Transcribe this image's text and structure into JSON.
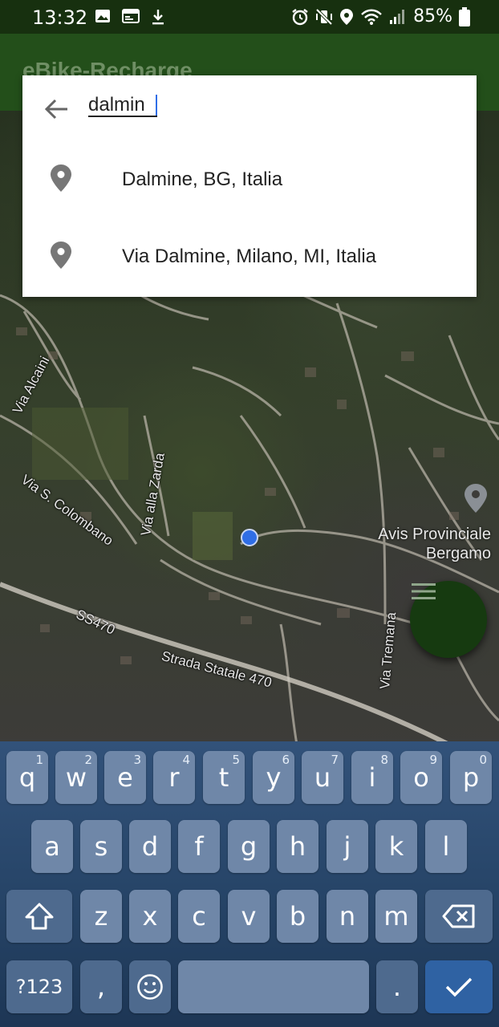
{
  "status_bar": {
    "time": "13:32",
    "battery": "85%",
    "left_icons": [
      "image-icon",
      "calendar-icon",
      "download-icon"
    ],
    "right_icons": [
      "alarm-icon",
      "vibrate-mute-icon",
      "location-icon",
      "wifi-icon",
      "signal-icon",
      "battery-icon"
    ]
  },
  "app_bar": {
    "title": "eBike-Recharge"
  },
  "search": {
    "value": "dalmin",
    "results": [
      {
        "label": "Dalmine, BG, Italia",
        "icon": "location-pin-icon"
      },
      {
        "label": "Via Dalmine, Milano, MI, Italia",
        "icon": "location-pin-icon"
      }
    ]
  },
  "map": {
    "labels": {
      "via_alcaini": "Via Alcaini",
      "via_s_colombano": "Via S. Colombano",
      "via_alla_zarda": "Via alla Zarda",
      "ss470": "SS470",
      "strada_statale": "Strada Statale 470",
      "via_tremana": "Via Tremana"
    },
    "poi": {
      "line1": "Avis Provinciale",
      "line2": "Bergamo"
    },
    "fab_icon": "menu-icon"
  },
  "keyboard": {
    "row1": [
      {
        "key": "q",
        "hint": "1"
      },
      {
        "key": "w",
        "hint": "2"
      },
      {
        "key": "e",
        "hint": "3"
      },
      {
        "key": "r",
        "hint": "4"
      },
      {
        "key": "t",
        "hint": "5"
      },
      {
        "key": "y",
        "hint": "6"
      },
      {
        "key": "u",
        "hint": "7"
      },
      {
        "key": "i",
        "hint": "8"
      },
      {
        "key": "o",
        "hint": "9"
      },
      {
        "key": "p",
        "hint": "0"
      }
    ],
    "row2": [
      "a",
      "s",
      "d",
      "f",
      "g",
      "h",
      "j",
      "k",
      "l"
    ],
    "row3": [
      "z",
      "x",
      "c",
      "v",
      "b",
      "n",
      "m"
    ],
    "sym": "?123",
    "comma": ",",
    "period": ".",
    "shift_icon": "shift-icon",
    "backspace_icon": "backspace-icon",
    "emoji_icon": "emoji-icon",
    "enter_icon": "checkmark-icon"
  }
}
